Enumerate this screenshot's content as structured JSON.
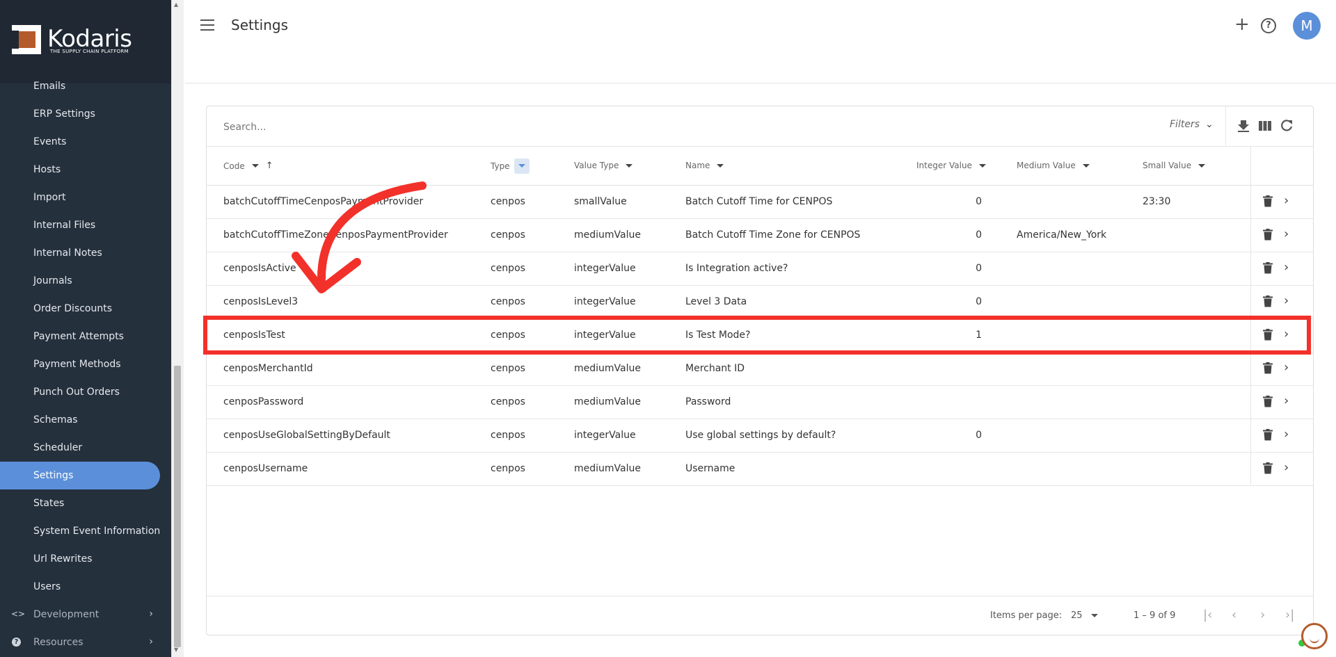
{
  "app": {
    "brand": "Kodaris",
    "brand_tagline": "THE SUPPLY CHAIN PLATFORM",
    "page_title": "Settings",
    "user_initial": "M"
  },
  "sidebar": {
    "items": [
      {
        "label": "Emails"
      },
      {
        "label": "ERP Settings"
      },
      {
        "label": "Events"
      },
      {
        "label": "Hosts"
      },
      {
        "label": "Import"
      },
      {
        "label": "Internal Files"
      },
      {
        "label": "Internal Notes"
      },
      {
        "label": "Journals"
      },
      {
        "label": "Order Discounts"
      },
      {
        "label": "Payment Attempts"
      },
      {
        "label": "Payment Methods"
      },
      {
        "label": "Punch Out Orders"
      },
      {
        "label": "Schemas"
      },
      {
        "label": "Scheduler"
      },
      {
        "label": "Settings",
        "active": true
      },
      {
        "label": "States"
      },
      {
        "label": "System Event Information"
      },
      {
        "label": "Url Rewrites"
      },
      {
        "label": "Users"
      }
    ],
    "sections": [
      {
        "label": "Development",
        "icon": "code-icon"
      },
      {
        "label": "Resources",
        "icon": "help-circle-icon"
      }
    ]
  },
  "toolbar": {
    "search_placeholder": "Search...",
    "filters_label": "Filters"
  },
  "table": {
    "columns": [
      "Code",
      "Type",
      "Value Type",
      "Name",
      "Integer Value",
      "Medium Value",
      "Small Value"
    ],
    "rows": [
      {
        "code": "batchCutoffTimeCenposPaymentProvider",
        "type": "cenpos",
        "value_type": "smallValue",
        "name": "Batch Cutoff Time for CENPOS",
        "integer_value": "0",
        "medium_value": "",
        "small_value": "23:30"
      },
      {
        "code": "batchCutoffTimeZoneCenposPaymentProvider",
        "type": "cenpos",
        "value_type": "mediumValue",
        "name": "Batch Cutoff Time Zone for CENPOS",
        "integer_value": "0",
        "medium_value": "America/New_York",
        "small_value": ""
      },
      {
        "code": "cenposIsActive",
        "type": "cenpos",
        "value_type": "integerValue",
        "name": "Is Integration active?",
        "integer_value": "0",
        "medium_value": "",
        "small_value": ""
      },
      {
        "code": "cenposIsLevel3",
        "type": "cenpos",
        "value_type": "integerValue",
        "name": "Level 3 Data",
        "integer_value": "0",
        "medium_value": "",
        "small_value": ""
      },
      {
        "code": "cenposIsTest",
        "type": "cenpos",
        "value_type": "integerValue",
        "name": "Is Test Mode?",
        "integer_value": "1",
        "medium_value": "",
        "small_value": ""
      },
      {
        "code": "cenposMerchantId",
        "type": "cenpos",
        "value_type": "mediumValue",
        "name": "Merchant ID",
        "integer_value": "",
        "medium_value": "",
        "small_value": ""
      },
      {
        "code": "cenposPassword",
        "type": "cenpos",
        "value_type": "mediumValue",
        "name": "Password",
        "integer_value": "",
        "medium_value": "",
        "small_value": ""
      },
      {
        "code": "cenposUseGlobalSettingByDefault",
        "type": "cenpos",
        "value_type": "integerValue",
        "name": "Use global settings by default?",
        "integer_value": "0",
        "medium_value": "",
        "small_value": ""
      },
      {
        "code": "cenposUsername",
        "type": "cenpos",
        "value_type": "mediumValue",
        "name": "Username",
        "integer_value": "",
        "medium_value": "",
        "small_value": ""
      }
    ]
  },
  "pagination": {
    "items_per_page_label": "Items per page:",
    "items_per_page": "25",
    "range": "1 – 9 of 9"
  },
  "annotation": {
    "highlight_color": "#f2312a",
    "highlighted_row": "cenposIsTest"
  },
  "colors": {
    "sidebar_bg": "#25303d",
    "accent": "#5b8fd9",
    "brand_orange": "#b55a2b"
  }
}
